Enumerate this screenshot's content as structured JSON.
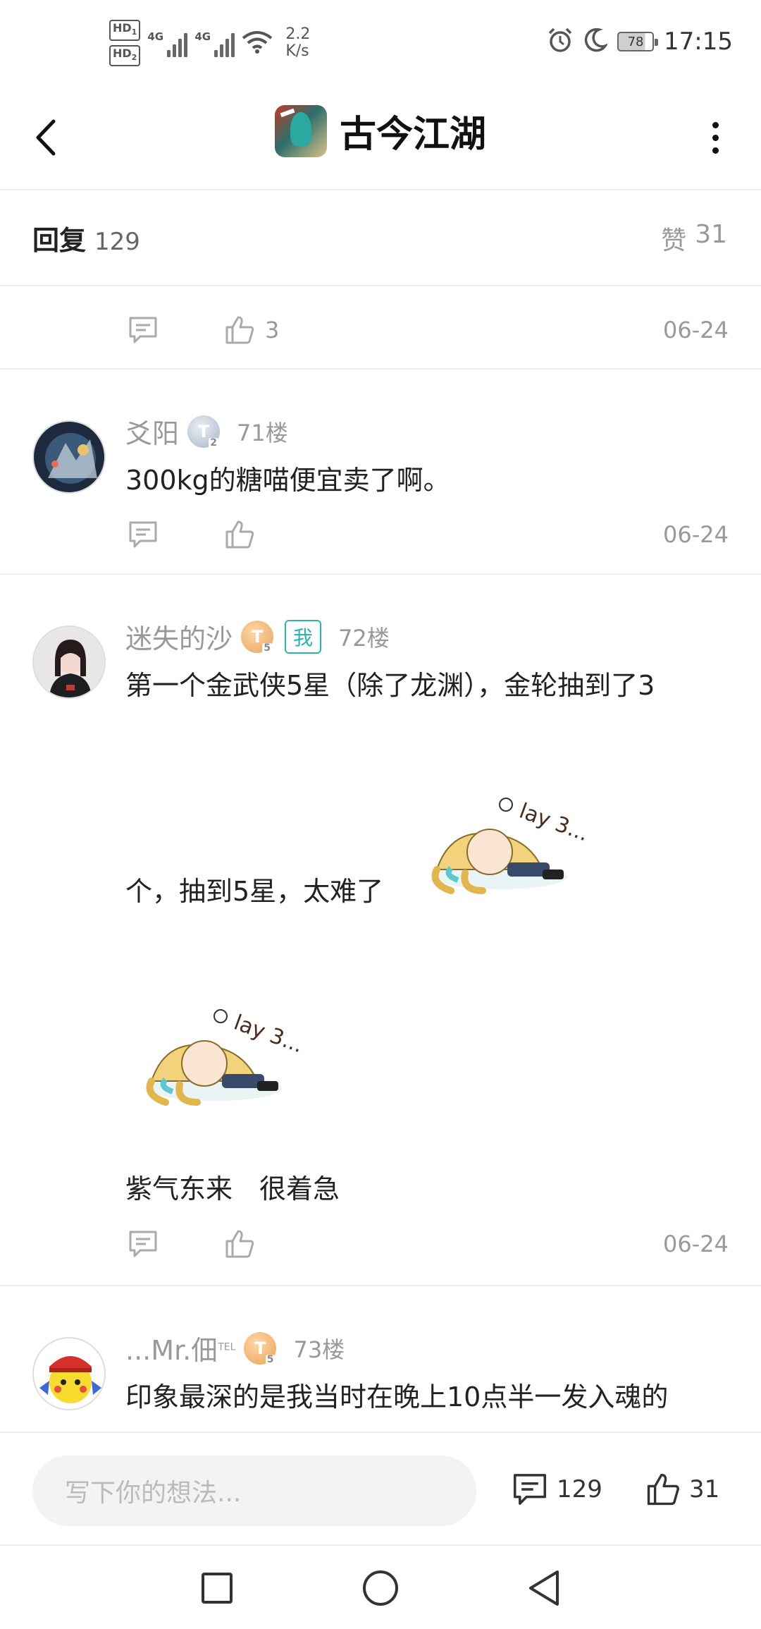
{
  "status_bar": {
    "hd1": "HD",
    "hd1_sub": "1",
    "hd2": "HD",
    "hd2_sub": "2",
    "net1": "4G",
    "net2": "4G",
    "speed_value": "2.2",
    "speed_unit": "K/s",
    "battery": "78",
    "time": "17:15"
  },
  "nav": {
    "title": "古今江湖"
  },
  "reply_header": {
    "label": "回复",
    "count": "129",
    "likes_label": "赞",
    "likes_count": "31"
  },
  "comments": [
    {
      "like_count": "3",
      "date": "06-24"
    },
    {
      "username": "爻阳",
      "level": "T",
      "level_sub": "2",
      "floor": "71楼",
      "text": "300kg的糖喵便宜卖了啊。",
      "date": "06-24"
    },
    {
      "username": "迷失的沙",
      "level": "T",
      "level_sub": "5",
      "me_tag": "我",
      "floor": "72楼",
      "text_line1": "第一个金武侠5星（除了龙渊），金轮抽到了3",
      "text_line2": "个，抽到5星，太难了",
      "text_line3": "紫气东来　很着急",
      "date": "06-24"
    },
    {
      "username": "...Mr.佃",
      "username_sup": "TEL",
      "level": "T",
      "level_sub": "5",
      "floor": "73楼",
      "text": "印象最深的是我当时在晚上10点半一发入魂的"
    }
  ],
  "bottom_bar": {
    "input_placeholder": "写下你的想法...",
    "reply_count": "129",
    "like_count": "31"
  },
  "icons": {
    "back": "back-arrow-icon",
    "more": "more-vertical-icon",
    "reply": "comment-bubble-icon",
    "like": "thumbs-up-icon",
    "alarm": "alarm-icon",
    "moon": "moon-icon",
    "wifi": "wifi-icon"
  },
  "colors": {
    "accent_teal": "#2bb3b0",
    "muted_text": "#999999"
  }
}
